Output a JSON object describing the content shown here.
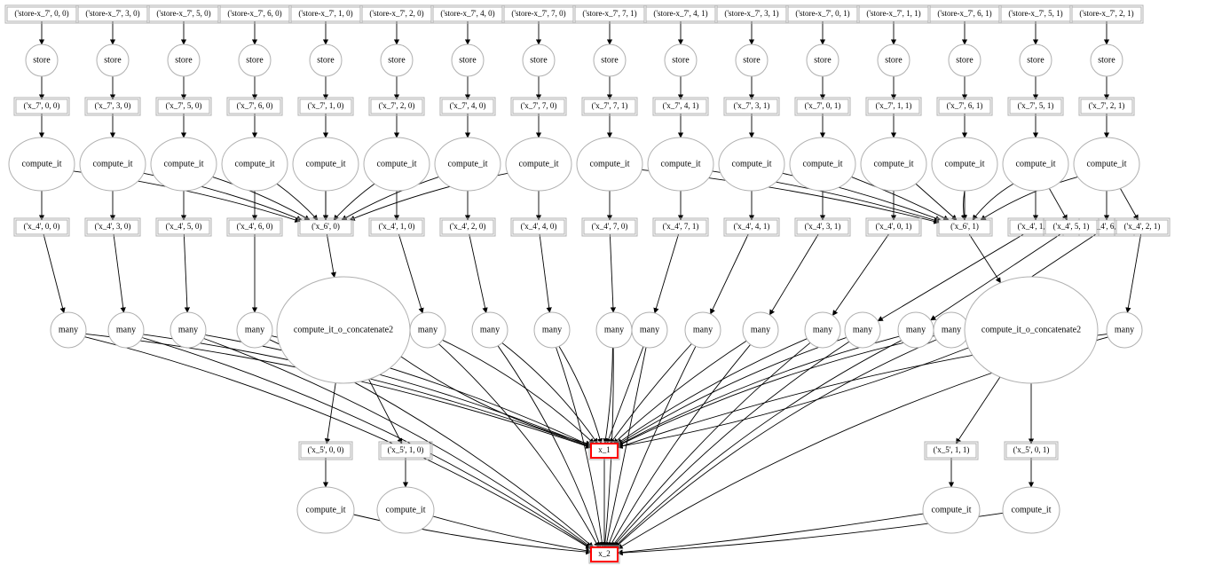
{
  "graph": {
    "columns": [
      {
        "top": "('store-x_7', 0, 0)",
        "x7": "('x_7', 0, 0)",
        "x4": "('x_4', 0, 0)"
      },
      {
        "top": "('store-x_7', 3, 0)",
        "x7": "('x_7', 3, 0)",
        "x4": "('x_4', 3, 0)"
      },
      {
        "top": "('store-x_7', 5, 0)",
        "x7": "('x_7', 5, 0)",
        "x4": "('x_4', 5, 0)"
      },
      {
        "top": "('store-x_7', 6, 0)",
        "x7": "('x_7', 6, 0)",
        "x4": "('x_4', 6, 0)"
      },
      {
        "top": "('store-x_7', 1, 0)",
        "x7": "('x_7', 1, 0)",
        "x6": "('x_6', 0)"
      },
      {
        "top": "('store-x_7', 2, 0)",
        "x7": "('x_7', 2, 0)",
        "x4": "('x_4', 1, 0)"
      },
      {
        "top": "('store-x_7', 4, 0)",
        "x7": "('x_7', 4, 0)",
        "x4": "('x_4', 2, 0)"
      },
      {
        "top": "('store-x_7', 7, 0)",
        "x7": "('x_7', 7, 0)",
        "x4": "('x_4', 4, 0)"
      },
      {
        "top": "('store-x_7', 7, 1)",
        "x7": "('x_7', 7, 1)",
        "x4": "('x_4', 7, 0)"
      },
      {
        "top": "('store-x_7', 4, 1)",
        "x7": "('x_7', 4, 1)",
        "x4": "('x_4', 7, 1)"
      },
      {
        "top": "('store-x_7', 3, 1)",
        "x7": "('x_7', 3, 1)",
        "x4": "('x_4', 4, 1)"
      },
      {
        "top": "('store-x_7', 0, 1)",
        "x7": "('x_7', 0, 1)",
        "x4": "('x_4', 3, 1)"
      },
      {
        "top": "('store-x_7', 1, 1)",
        "x7": "('x_7', 1, 1)",
        "x4": "('x_4', 0, 1)"
      },
      {
        "top": "('store-x_7', 6, 1)",
        "x7": "('x_7', 6, 1)",
        "x6": "('x_6', 1)"
      },
      {
        "top": "('store-x_7', 5, 1)",
        "x7": "('x_7', 5, 1)",
        "x4": "('x_4', 1, 1)"
      },
      {
        "top": "('store-x_7', 2, 1)",
        "x7": "('x_7', 2, 1)",
        "x4": "('x_4', 6, 1)"
      }
    ],
    "extra_x4_col15": "('x_4', 5, 1)",
    "extra_x4_col16": "('x_4', 2, 1)",
    "labels": {
      "store": "store",
      "compute_it": "compute_it",
      "concat": "compute_it_o_concatenate2",
      "many": "many",
      "x1": "x_1",
      "x2": "x_2"
    },
    "x5": {
      "left0": "('x_5', 0, 0)",
      "left1": "('x_5', 1, 0)",
      "right0": "('x_5', 1, 1)",
      "right1": "('x_5', 0, 1)"
    }
  }
}
